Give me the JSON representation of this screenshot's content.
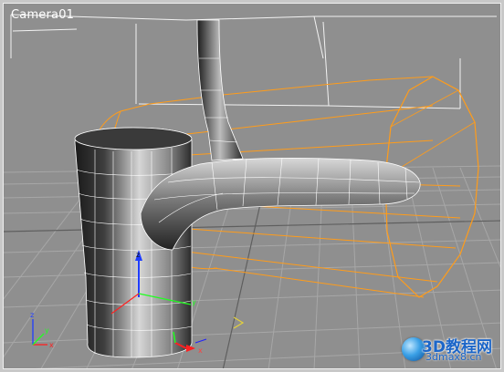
{
  "viewport": {
    "label": "Camera01",
    "background": "#8f8f8f",
    "grid_color": "#a9a9a9",
    "wire_color": "#ffffff",
    "selection_color": "#ff9c1a"
  },
  "gizmo": {
    "x_label": "x",
    "y_label": "y",
    "z_label": "z"
  },
  "world_axis": {
    "x_label": "x",
    "y_label": "y",
    "z_label": "z"
  },
  "watermark": {
    "title": "3D教程网",
    "url": "3dmax8.cn"
  }
}
